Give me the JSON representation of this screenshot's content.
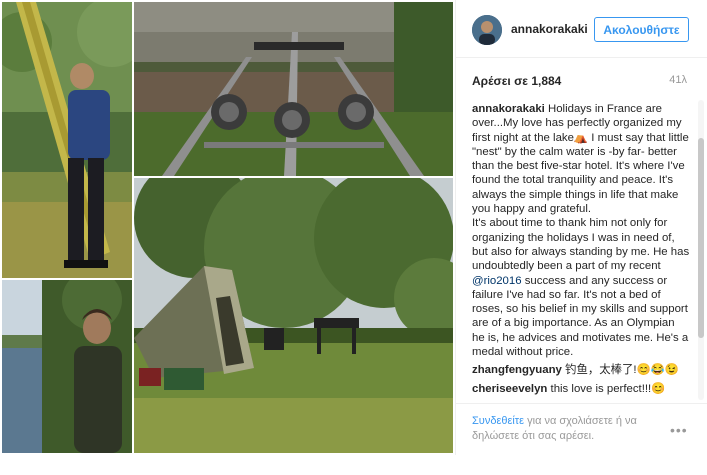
{
  "post": {
    "username": "annakorakaki",
    "follow_label": "Ακολουθήστε",
    "likes_text": "Αρέσει σε 1,884",
    "age_text": "41λ"
  },
  "caption": {
    "author": "annakorakaki",
    "p1": "Holidays in France are over...My love has perfectly organized my first night at the lake⛺ I must say that little \"nest\" by the calm water is -by far- better than the best five-star hotel. It's where I've found the total tranquility and peace. It's always the simple things in life that make you happy and grateful.",
    "p2a": "It's about time to thank him not only for organizing the holidays I was in need of, but also for always standing by me. He has undoubtedly been a part of my recent ",
    "mention": "@rio2016",
    "p2b": " success and any success or failure I've had so far. It's not a bed of roses, so his belief in my skills and support are of a big importance. As an Olympian he is, he advices and motivates me. He's a medal without price."
  },
  "comments": [
    {
      "author": "zhangfengyuany",
      "text": "钓鱼，太棒了!😊😂😉"
    },
    {
      "author": "cheriseevelyn",
      "text": "this love is perfect!!!😊"
    }
  ],
  "footer": {
    "login_link": "Συνδεθείτε",
    "login_rest": " για να σχολιάσετε ή να δηλώσετε ότι σας αρέσει.",
    "more_label": "•••"
  },
  "icons": {
    "more": "more-options-icon"
  },
  "colors": {
    "accent": "#3897f0",
    "text": "#262626",
    "muted": "#999999",
    "mention": "#003569"
  }
}
